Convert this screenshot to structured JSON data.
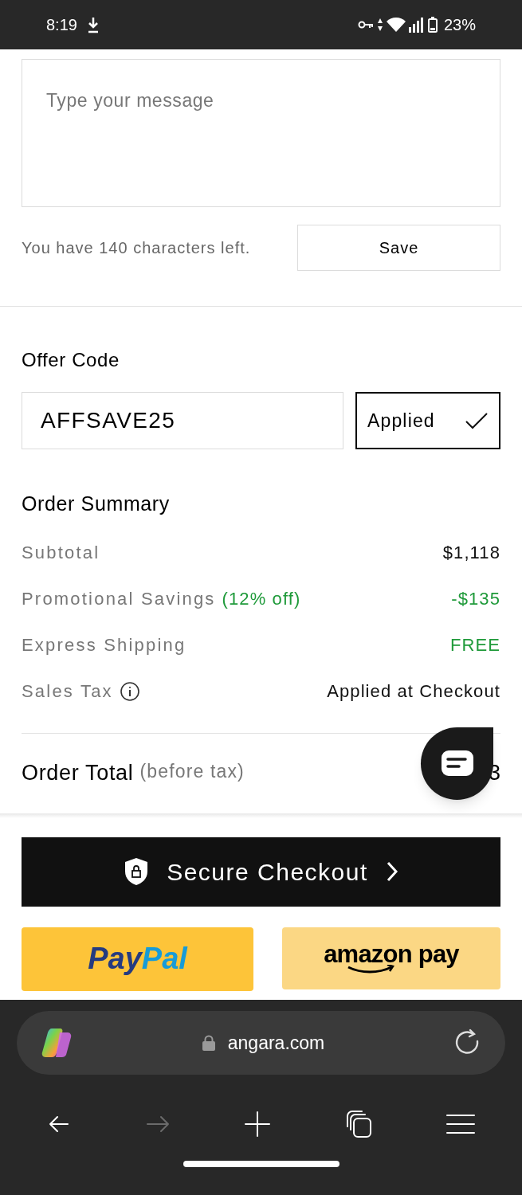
{
  "status_bar": {
    "time": "8:19",
    "battery": "23%"
  },
  "message": {
    "placeholder": "Type your message",
    "counter": "You have 140 characters left.",
    "save": "Save"
  },
  "offer_code": {
    "label": "Offer Code",
    "value": "AFFSAVE25",
    "button": "Applied",
    "applied": true
  },
  "order_summary": {
    "title": "Order Summary",
    "rows": [
      {
        "kind": "plain",
        "label": "Subtotal",
        "value": "$1,118"
      },
      {
        "kind": "promo",
        "label": "Promotional Savings",
        "note": "(12% off)",
        "value": "-$135"
      },
      {
        "kind": "promo",
        "label": "Express Shipping",
        "value": "FREE"
      },
      {
        "kind": "info",
        "label": "Sales Tax",
        "value": "Applied at Checkout"
      }
    ],
    "total_label": "Order Total",
    "total_note": "(before tax)",
    "total_value": "3"
  },
  "checkout": "Secure Checkout",
  "paypal": [
    {
      "text": "Pay",
      "color": "#253b80"
    },
    {
      "text": "Pal",
      "color": "#179bd7"
    }
  ],
  "amazon_pay": "amazon pay",
  "browser": {
    "url": "angara.com",
    "nav": [
      {
        "kind": "back",
        "disabled": false
      },
      {
        "kind": "forward",
        "disabled": true
      },
      {
        "kind": "new-tab",
        "disabled": false
      },
      {
        "kind": "tabs",
        "disabled": false
      },
      {
        "kind": "menu",
        "disabled": false
      }
    ]
  }
}
